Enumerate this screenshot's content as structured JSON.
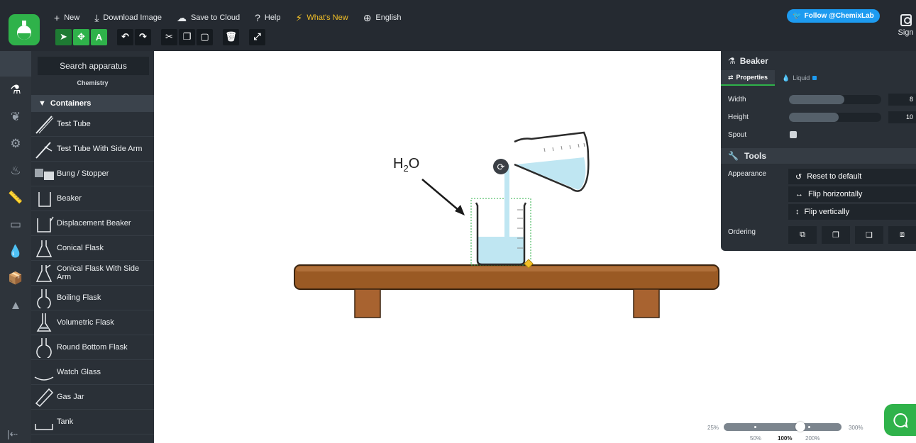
{
  "topbar": {
    "menu": [
      {
        "icon": "plus-icon",
        "label": "New"
      },
      {
        "icon": "download-icon",
        "label": "Download Image"
      },
      {
        "icon": "cloud-upload-icon",
        "label": "Save to Cloud"
      },
      {
        "icon": "question-icon",
        "label": "Help"
      },
      {
        "icon": "bolt-icon",
        "label": "What's New"
      },
      {
        "icon": "globe-icon",
        "label": "English"
      }
    ],
    "follow_label": "Follow @ChemixLab",
    "sign_label": "Sign"
  },
  "sidebar": {
    "search_placeholder": "Search apparatus",
    "category": "Chemistry",
    "section": "Containers",
    "items": [
      {
        "label": "Test Tube",
        "icon": "test-tube-icon"
      },
      {
        "label": "Test Tube With Side Arm",
        "icon": "test-tube-side-arm-icon"
      },
      {
        "label": "Bung / Stopper",
        "icon": "bung-icon"
      },
      {
        "label": "Beaker",
        "icon": "beaker-icon"
      },
      {
        "label": "Displacement Beaker",
        "icon": "displacement-beaker-icon"
      },
      {
        "label": "Conical Flask",
        "icon": "conical-flask-icon"
      },
      {
        "label": "Conical Flask With Side Arm",
        "icon": "conical-flask-side-arm-icon"
      },
      {
        "label": "Boiling Flask",
        "icon": "boiling-flask-icon"
      },
      {
        "label": "Volumetric Flask",
        "icon": "volumetric-flask-icon"
      },
      {
        "label": "Round Bottom Flask",
        "icon": "round-bottom-flask-icon"
      },
      {
        "label": "Watch Glass",
        "icon": "watch-glass-icon"
      },
      {
        "label": "Gas Jar",
        "icon": "gas-jar-icon"
      },
      {
        "label": "Tank",
        "icon": "tank-icon"
      }
    ]
  },
  "canvas": {
    "label_main": "H",
    "label_sub": "2",
    "label_tail": "O"
  },
  "properties": {
    "title": "Beaker",
    "tabs": [
      "Properties",
      "Liquid"
    ],
    "width_label": "Width",
    "width_value": "8",
    "height_label": "Height",
    "height_value": "10",
    "spout_label": "Spout",
    "tools_title": "Tools",
    "appearance_label": "Appearance",
    "buttons": [
      "Reset to default",
      "Flip horizontally",
      "Flip vertically"
    ],
    "ordering_label": "Ordering"
  },
  "zoom": {
    "min": "25%",
    "max": "300%",
    "marks": [
      "50%",
      "100%",
      "200%"
    ],
    "current": "100%"
  },
  "colors": {
    "accent": "#2fb24a",
    "twitter": "#1d9bf0",
    "liquid": "#bfe6f2"
  }
}
